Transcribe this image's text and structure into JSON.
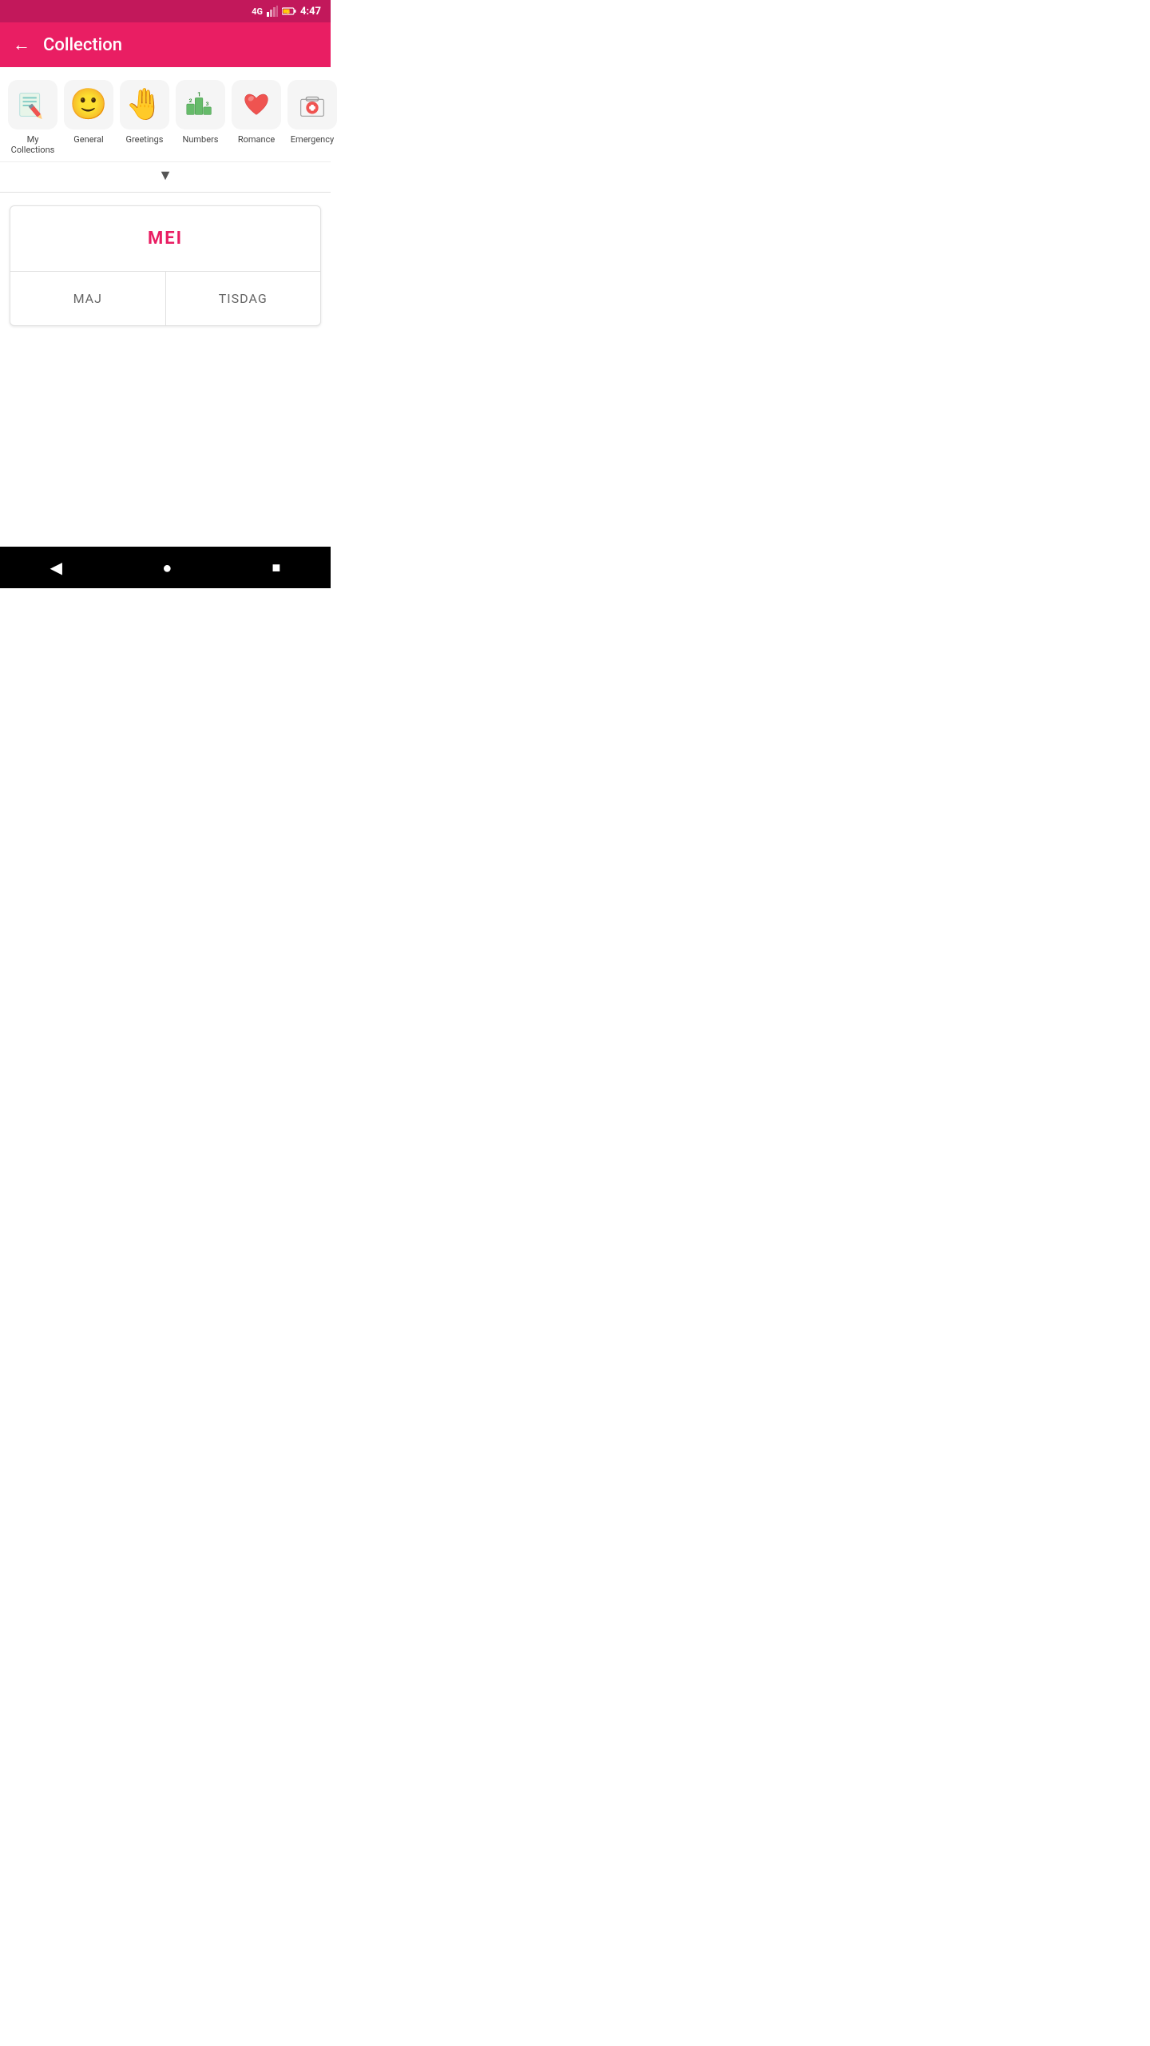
{
  "statusBar": {
    "network": "4G",
    "time": "4:47"
  },
  "appBar": {
    "title": "Collection",
    "backLabel": "←"
  },
  "categories": [
    {
      "id": "my-collections",
      "label": "My Collections",
      "iconType": "my-collections"
    },
    {
      "id": "general",
      "label": "General",
      "iconType": "general"
    },
    {
      "id": "greetings",
      "label": "Greetings",
      "iconType": "greetings"
    },
    {
      "id": "numbers",
      "label": "Numbers",
      "iconType": "numbers"
    },
    {
      "id": "romance",
      "label": "Romance",
      "iconType": "romance"
    },
    {
      "id": "emergency",
      "label": "Emergency",
      "iconType": "emergency"
    }
  ],
  "expandButton": {
    "label": "▼"
  },
  "card": {
    "headerText": "MEI",
    "footerLeft": "MAJ",
    "footerRight": "TISDAG"
  },
  "navBar": {
    "back": "◀",
    "home": "●",
    "recent": "■"
  }
}
